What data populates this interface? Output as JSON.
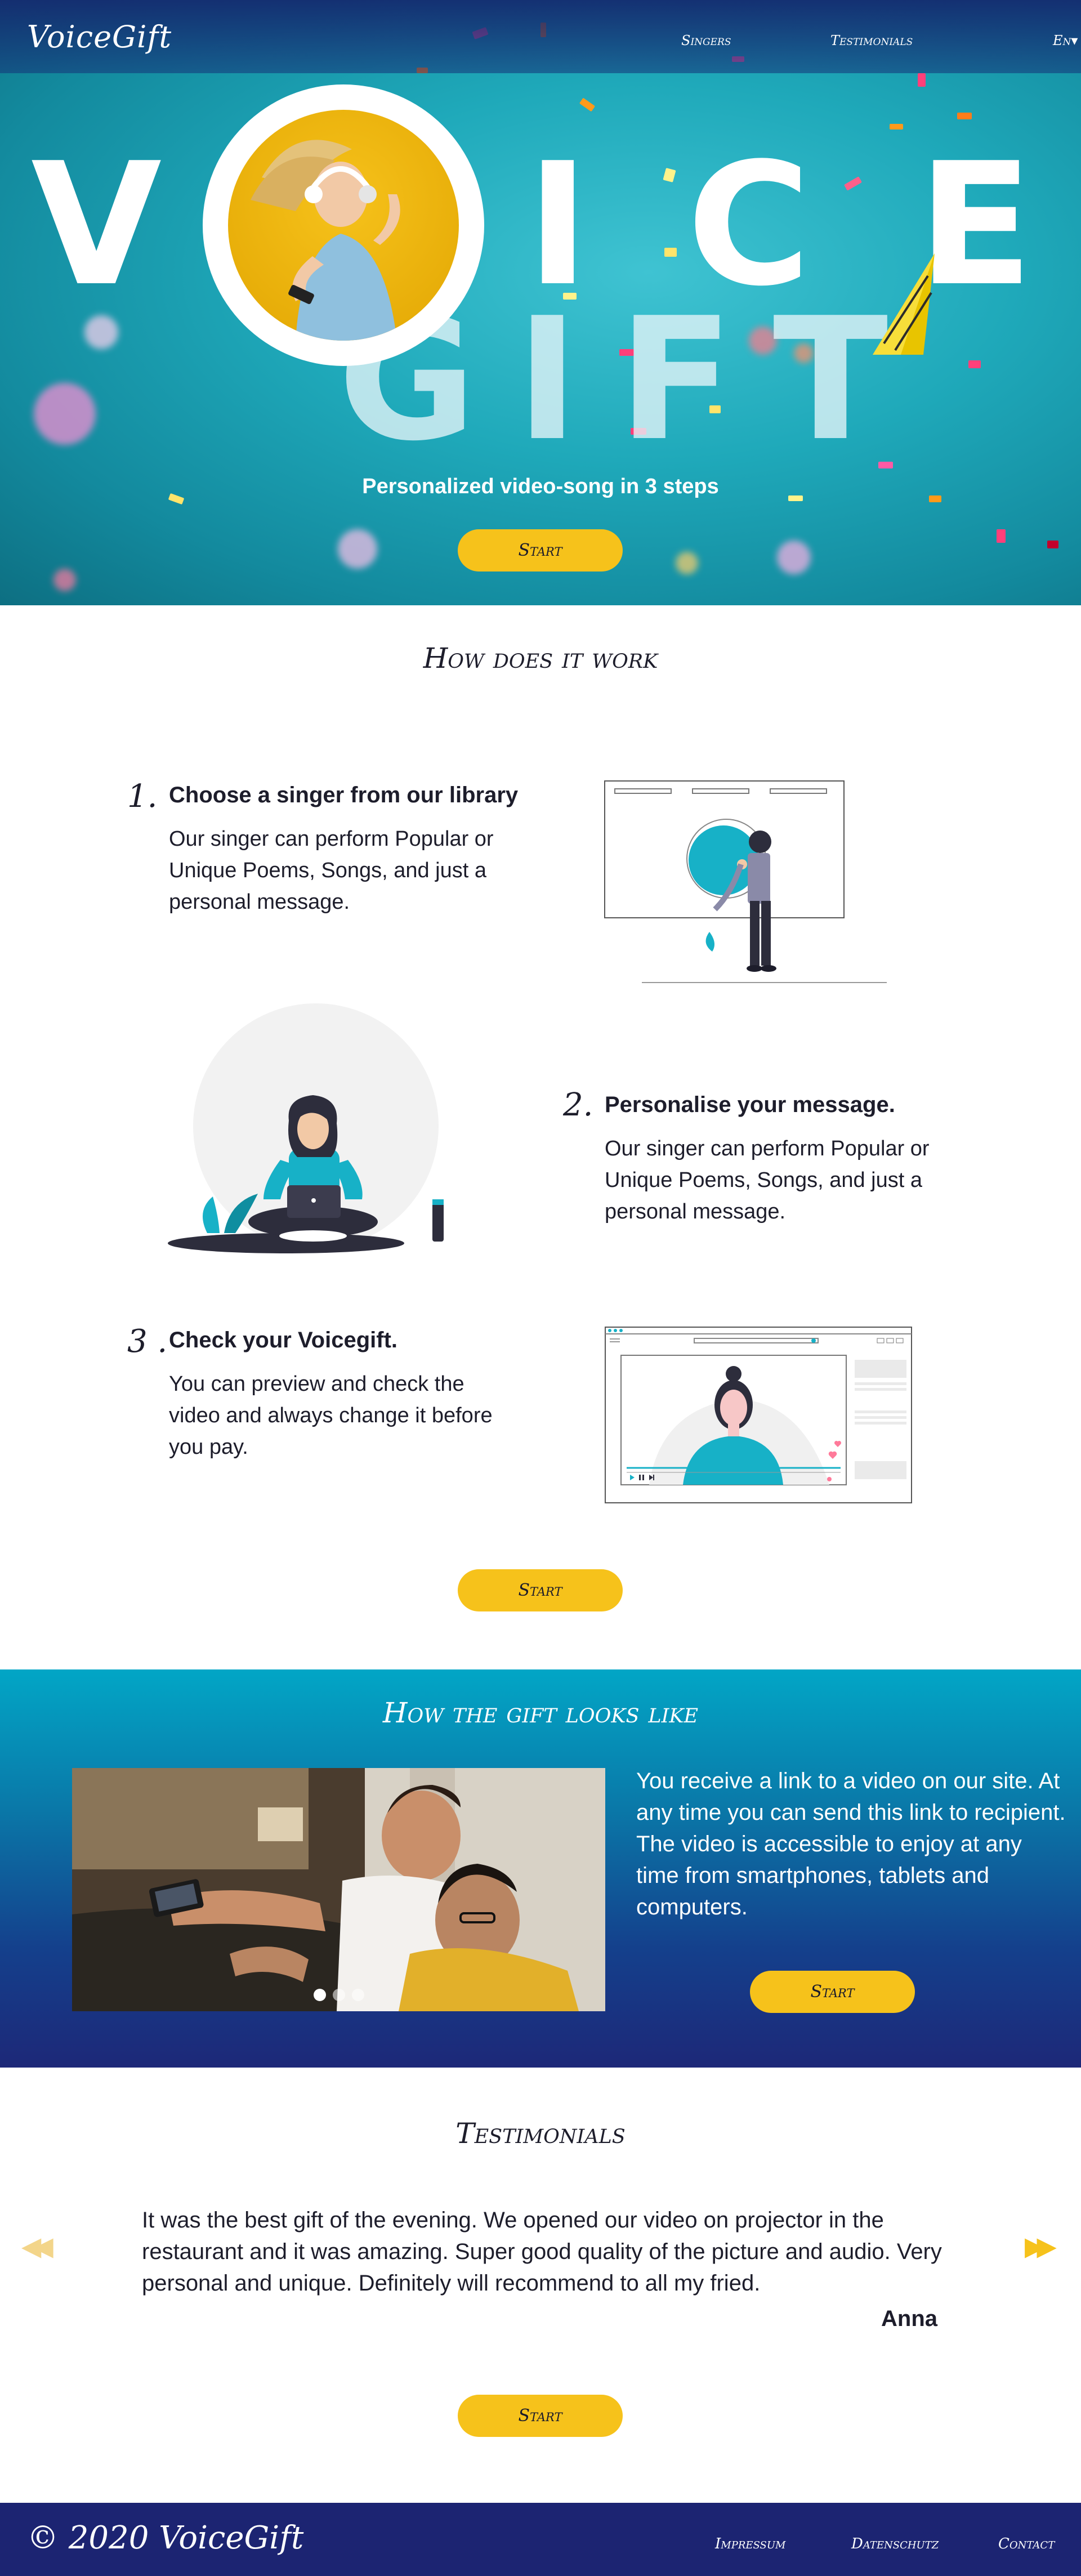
{
  "header": {
    "logo": "VoiceGift",
    "nav": {
      "singers": "Singers",
      "testimonials": "Testimonials",
      "language": "En▾"
    }
  },
  "hero": {
    "word_voice": {
      "v": "V",
      "i": "I",
      "c": "C",
      "e": "E"
    },
    "word_gift": "GIFT",
    "tagline": "Personalized  video-song in 3 steps",
    "start_label": "Start"
  },
  "how": {
    "title": "How does it work",
    "steps": [
      {
        "number": "1.",
        "title": "Choose a singer from our library",
        "text": "Our singer can perform Popular or Unique Poems, Songs, and just a personal message."
      },
      {
        "number": "2.",
        "title": "Personalise your message.",
        "text": "Our singer can perform Popular or Unique Poems, Songs, and just a personal message."
      },
      {
        "number": "3 .",
        "title": "Check your Voicegift.",
        "text": "You can preview and check the video and always change it before you pay."
      }
    ],
    "start_label": "Start"
  },
  "gift_look": {
    "title": "How the gift looks like",
    "text": "You receive a link to a video on our site. At any time you can send this link to recipient. The video is accessible to enjoy at any time from smartphones, tablets and computers.",
    "start_label": "Start",
    "slide_count": 3,
    "active_slide": 0
  },
  "testimonials": {
    "title": "Testimonials",
    "quote": "It was the best gift of the evening. We opened our video on projector in the restaurant and it was amazing. Super good quality of the picture and audio. Very personal and unique. Definitely will recommend to all my fried.",
    "author": "Anna",
    "prev_icon": "rewind-icon",
    "next_icon": "fast-forward-icon",
    "start_label": "Start"
  },
  "footer": {
    "copyright": "© 2020 VoiceGift",
    "links": {
      "impressum": "Impressum",
      "datenschutz": "Datenschutz",
      "contact": "Contact"
    }
  },
  "colors": {
    "accent": "#f6c21b",
    "hero_teal": "#1fa9ba",
    "navy": "#1c2472",
    "text": "#1d1d2b"
  }
}
